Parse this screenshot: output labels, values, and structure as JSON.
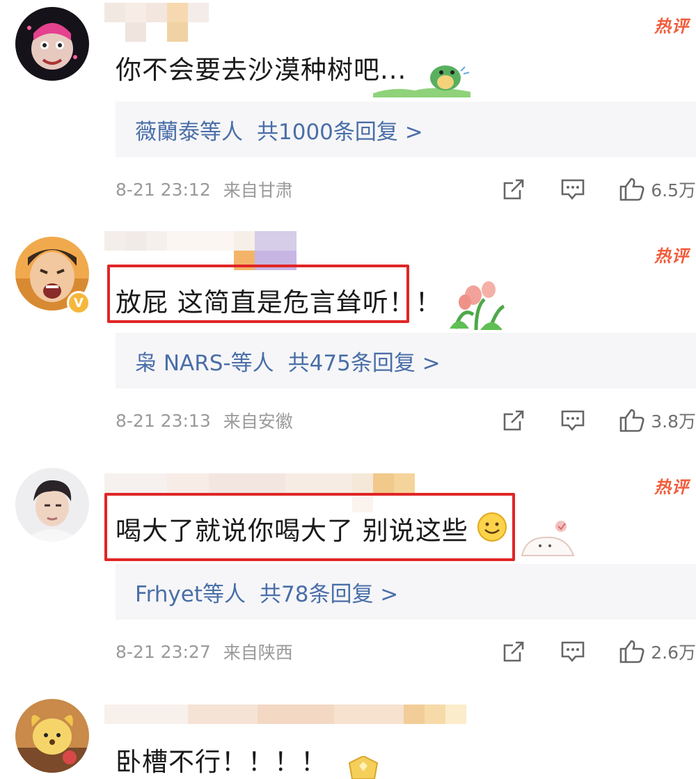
{
  "comments": [
    {
      "text": "你不会要去沙漠种树吧...",
      "hot_badge": "热评",
      "reply_names": "薇蘭泰等人",
      "reply_count": "共1000条回复 >",
      "time": "8-21 23:12",
      "location": "来自甘肃",
      "likes": "6.5万",
      "avatar": "cartoon-face-avatar",
      "sticker": "turtle-sticker"
    },
    {
      "text": "放屁 这简直是危言耸听！！",
      "hot_badge": "热评",
      "reply_names": "枭 NARS-等人",
      "reply_count": "共475条回复 >",
      "time": "8-21 23:13",
      "location": "来自安徽",
      "likes": "3.8万",
      "avatar": "crying-kid-avatar",
      "verified_mark": "V",
      "sticker": "tulip-sticker"
    },
    {
      "text": "喝大了就说你喝大了 别说这些",
      "hot_badge": "热评",
      "reply_names": "Frhyet等人",
      "reply_count": "共78条回复 >",
      "time": "8-21 23:27",
      "location": "来自陕西",
      "likes": "2.6万",
      "avatar": "man-portrait-avatar",
      "emoji": "smile-emoji",
      "sticker": "cat-sticker"
    },
    {
      "text": "卧槽不行！！！！",
      "avatar": "cartoon-dog-avatar",
      "sticker": "gold-badge-sticker"
    }
  ],
  "colors": {
    "hot_badge": "#f25c3b",
    "reply_link": "#4a6ea8",
    "highlight_box": "#e02626",
    "reply_panel_bg": "#f6f6f8",
    "meta_text": "#9a9a9a"
  }
}
